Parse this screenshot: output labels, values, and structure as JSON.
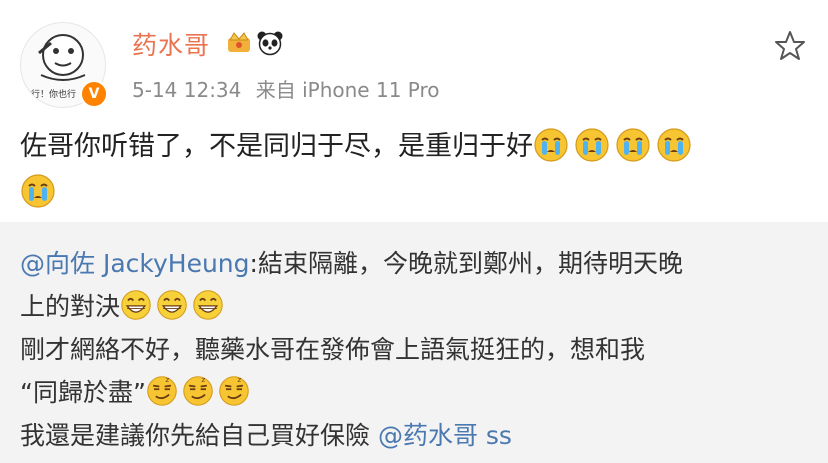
{
  "post": {
    "username": "药水哥",
    "timestamp": "5-14 12:34",
    "source": "来自 iPhone 11 Pro",
    "avatar_text": "行！你也行",
    "verified_mark": "V",
    "content_text": "佐哥你听错了，不是同归于尽，是重归于好",
    "content_emojis": [
      "crying-face",
      "crying-face",
      "crying-face",
      "crying-face",
      "crying-face"
    ]
  },
  "repost": {
    "mention": "@向佐 JackyHeung",
    "line1_text": ":結束隔離，今晚就到鄭州，期待明天晚",
    "line2_text": "上的對決",
    "line2_emojis": [
      "grin-face",
      "grin-face",
      "grin-face"
    ],
    "line3_text": "剛才網絡不好，聽藥水哥在發佈會上語氣挺狂的，想和我",
    "line4_text": "“同歸於盡”",
    "line4_emojis": [
      "smug-face",
      "smug-face",
      "smug-face"
    ],
    "line5_text": "我還是建議你先給自己買好保險 ",
    "line5_mention": "@药水哥 ss"
  },
  "colors": {
    "username": "#eb7350",
    "mention": "#4a78b0",
    "repost_bg": "#f3f3f3"
  }
}
